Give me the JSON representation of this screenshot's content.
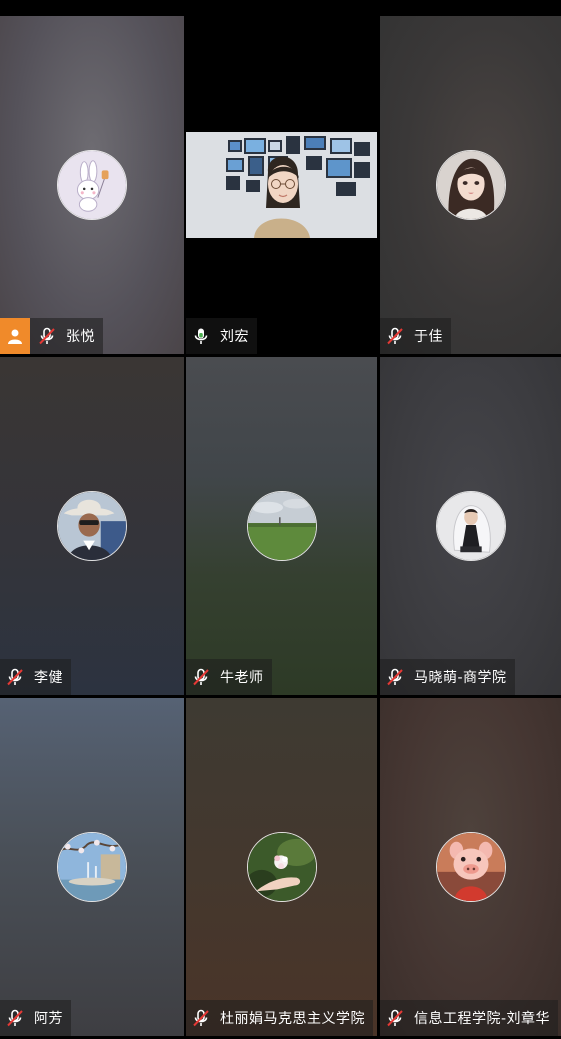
{
  "participants": [
    {
      "name": "张悦",
      "mic": "muted",
      "host": true,
      "avatar": "bunny-avatar",
      "bg": [
        "#6c6a70",
        "#4a4448"
      ]
    },
    {
      "name": "刘宏",
      "mic": "on",
      "host": false,
      "video": true,
      "bg": [
        "#000000",
        "#000000"
      ]
    },
    {
      "name": "于佳",
      "mic": "muted",
      "host": false,
      "avatar": "girl-portrait-avatar",
      "bg": [
        "#3a3a3a",
        "#4c4644"
      ]
    },
    {
      "name": "李健",
      "mic": "muted",
      "host": false,
      "avatar": "man-hat-avatar",
      "bg": [
        "#3a3634",
        "#2c3340"
      ]
    },
    {
      "name": "牛老师",
      "mic": "muted",
      "host": false,
      "avatar": "grassland-avatar",
      "bg": [
        "#4a4c50",
        "#2d3a26"
      ]
    },
    {
      "name": "马晓萌-商学院",
      "mic": "muted",
      "host": false,
      "avatar": "woman-veil-avatar",
      "bg": [
        "#3e3e42",
        "#3a3a3e"
      ]
    },
    {
      "name": "阿芳",
      "mic": "muted",
      "host": false,
      "avatar": "fountain-avatar",
      "bg": [
        "#566274",
        "#3a3a3e"
      ]
    },
    {
      "name": "杜丽娟马克思主义学院",
      "mic": "muted",
      "host": false,
      "avatar": "flower-hand-avatar",
      "bg": [
        "#3e3a32",
        "#4a3428"
      ]
    },
    {
      "name": "信息工程学院-刘章华",
      "mic": "muted",
      "host": false,
      "avatar": "pig-cartoon-avatar",
      "bg": [
        "#4a3e38",
        "#3a2e2a"
      ]
    }
  ],
  "colors": {
    "host_badge": "#f08a2a",
    "mic_muted_slash": "#e53935",
    "label_text": "#ffffff",
    "background": "#000000"
  }
}
